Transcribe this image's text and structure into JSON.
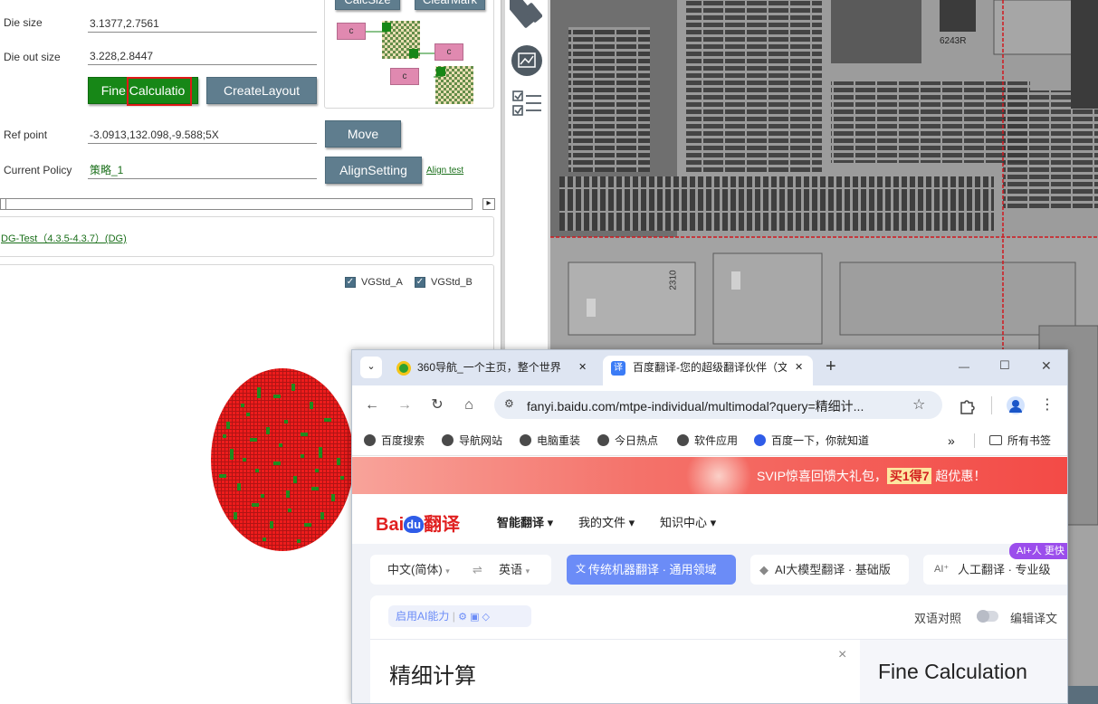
{
  "left_panel": {
    "die_size_label": "Die size",
    "die_size_value": "3.1377,2.7561",
    "die_out_size_label": "Die out size",
    "die_out_size_value": "3.228,2.8447",
    "fine_calculation_button": "Fine Calculatio",
    "create_layout_button": "CreateLayout",
    "calcsize_button": "CalcSize",
    "clearmark_button": "ClearMark",
    "node_label": "c",
    "ref_point_label": "Ref point",
    "ref_point_value": "-3.0913,132.098,-9.588;5X",
    "move_button": "Move",
    "current_policy_label": "Current Policy",
    "current_policy_value": "策略_1",
    "align_setting_button": "AlignSetting",
    "align_test_link": "Align test",
    "scroll_right_arrow": "▸",
    "recipe_link": "DG-Test（4.3.5-4.3.7）(DG)",
    "checkbox_a_label": "VGStd_A",
    "checkbox_b_label": "VGStd_B",
    "checkbox_a_checked": true,
    "checkbox_b_checked": true,
    "colors": {
      "button": "#5f7d8e",
      "button_green": "#178717",
      "highlight": "#e01818",
      "wafer_red": "#ee1c1c",
      "wafer_green": "#1f8c1f"
    }
  },
  "viewer": {
    "chip_label_1": "6243R",
    "chip_label_2": "2310",
    "colors": {
      "grid_line": "#d0181e"
    }
  },
  "browser": {
    "tabs": [
      {
        "title": "360导航_一个主页，整个世界",
        "active": false
      },
      {
        "title": "百度翻译-您的超级翻译伙伴（文",
        "active": true
      }
    ],
    "tab_close": "✕",
    "new_tab": "+",
    "window_controls": {
      "minimize": "—",
      "maximize": "☐",
      "close": "✕"
    },
    "url": "fanyi.baidu.com/mtpe-individual/multimodal?query=精细计...",
    "bookmarks": [
      "百度搜索",
      "导航网站",
      "电脑重装",
      "今日热点",
      "软件应用",
      "百度一下，你就知道"
    ],
    "bookmarks_more": "»",
    "all_bookmarks": "所有书签",
    "promo_text": "SVIP惊喜回馈大礼包，",
    "promo_highlight": "买1得7",
    "promo_suffix": " 超优惠！",
    "baidu_logo_bai": "Bai",
    "baidu_logo_du": "du",
    "baidu_logo_fanyi": "翻译",
    "nav": [
      "智能翻译",
      "我的文件",
      "知识中心"
    ],
    "source_lang": "中文(简体)",
    "target_lang": "英语",
    "swap_icon": "⇌",
    "modes": [
      {
        "label": "传统机器翻译 · 通用领域",
        "active": true
      },
      {
        "label": "AI大模型翻译 · 基础版",
        "active": false
      },
      {
        "label": "人工翻译 · 专业级",
        "active": false
      }
    ],
    "ai_badge": "AI+人 更快",
    "enable_ai": "启用AI能力",
    "bilingual": "双语对照",
    "edit_translation": "编辑译文",
    "source_text": "精细计算",
    "clear_icon": "×",
    "target_text": "Fine Calculation",
    "colors": {
      "tab_strip": "#dee5f2",
      "accent": "#6b8cf7",
      "promo_red": "#f34a46",
      "logo_red": "#e02020",
      "logo_blue": "#2f5ce8"
    }
  }
}
